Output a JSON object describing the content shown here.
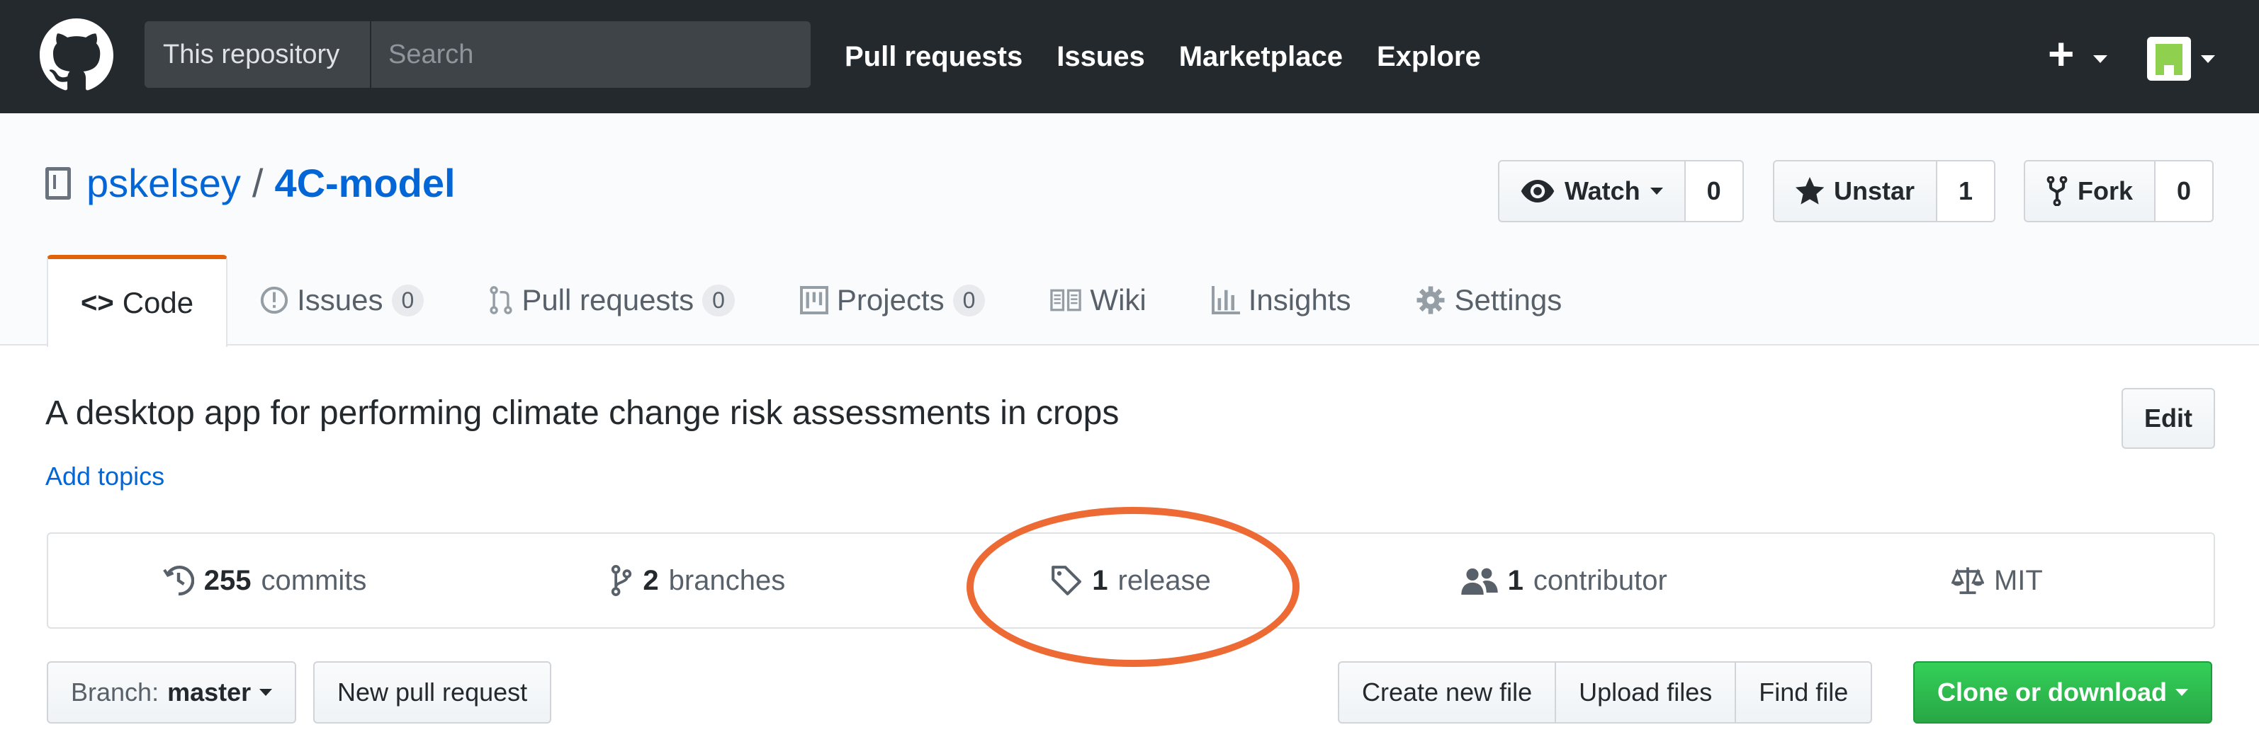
{
  "header": {
    "search_scope": "This repository",
    "search_placeholder": "Search",
    "nav": [
      "Pull requests",
      "Issues",
      "Marketplace",
      "Explore"
    ],
    "plus_label": "+"
  },
  "repo": {
    "owner": "pskelsey",
    "separator": "/",
    "name": "4C-model",
    "watch": {
      "label": "Watch",
      "count": "0"
    },
    "star": {
      "label": "Unstar",
      "count": "1"
    },
    "fork": {
      "label": "Fork",
      "count": "0"
    }
  },
  "tabs": [
    {
      "label": "Code",
      "icon": "code-icon"
    },
    {
      "label": "Issues",
      "count": "0",
      "icon": "issue-icon"
    },
    {
      "label": "Pull requests",
      "count": "0",
      "icon": "pull-request-icon"
    },
    {
      "label": "Projects",
      "count": "0",
      "icon": "project-icon"
    },
    {
      "label": "Wiki",
      "icon": "book-icon"
    },
    {
      "label": "Insights",
      "icon": "graph-icon"
    },
    {
      "label": "Settings",
      "icon": "gear-icon"
    }
  ],
  "description": "A desktop app for performing climate change risk assessments in crops",
  "add_topics": "Add topics",
  "edit_label": "Edit",
  "summary": {
    "commits": {
      "count": "255",
      "label": "commits"
    },
    "branches": {
      "count": "2",
      "label": "branches"
    },
    "releases": {
      "count": "1",
      "label": "release"
    },
    "contributors": {
      "count": "1",
      "label": "contributor"
    },
    "license": "MIT"
  },
  "filebar": {
    "branch_prefix": "Branch:",
    "branch_name": "master",
    "new_pr": "New pull request",
    "create_file": "Create new file",
    "upload_files": "Upload files",
    "find_file": "Find file",
    "clone": "Clone or download"
  },
  "colors": {
    "annotation": "#ed6a34",
    "accent_tab": "#e36209",
    "clone_green": "#28a745"
  }
}
